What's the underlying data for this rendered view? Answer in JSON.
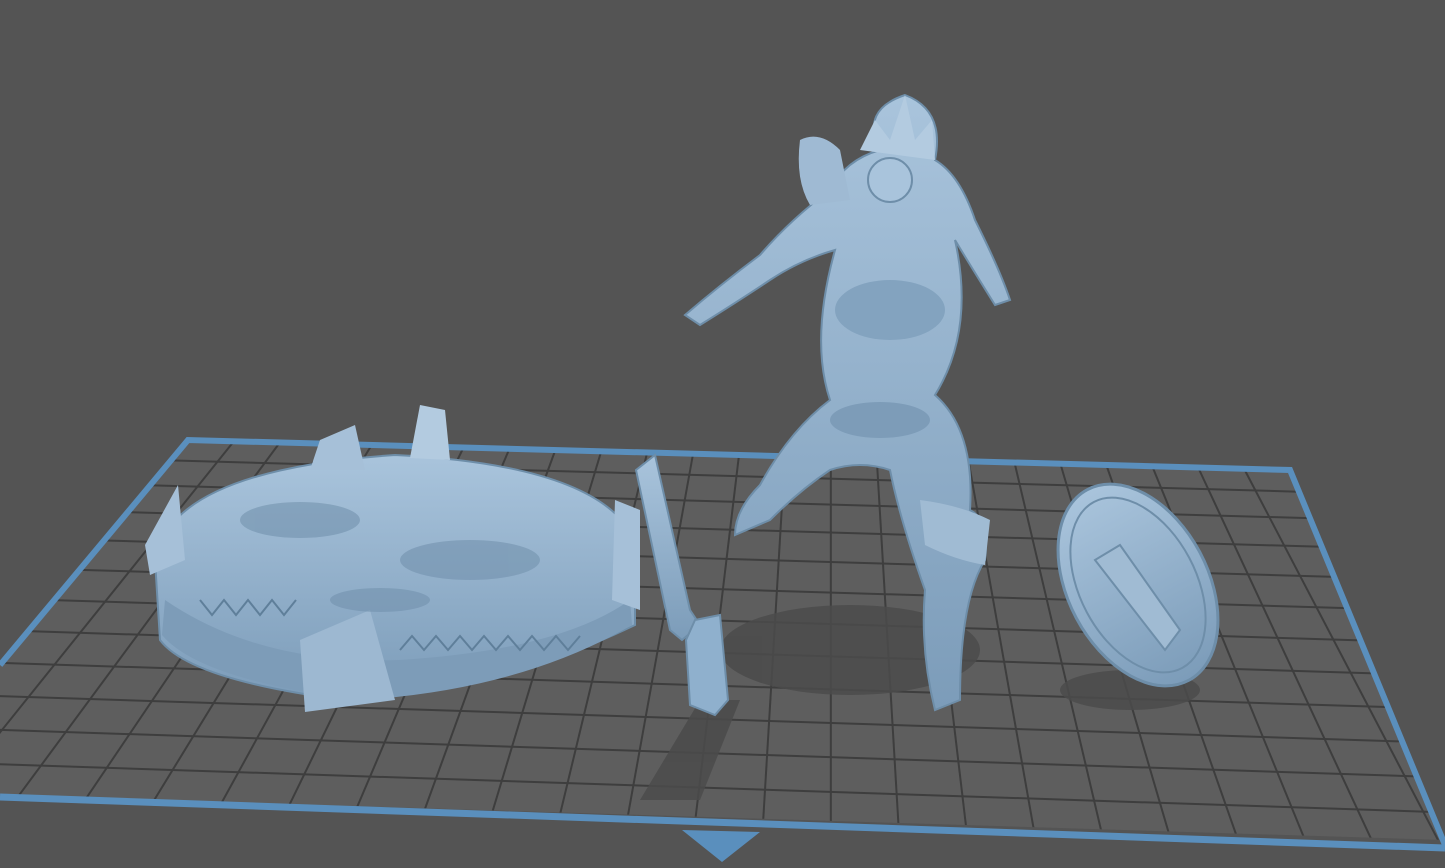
{
  "viewport": {
    "background": "#545454",
    "plate_fill": "#5e5e5e",
    "grid_line": "#3e3e3e",
    "plate_border": "#5a8fbd",
    "model_color": "#8fb0cd",
    "model_shadow": "#4a4a4a",
    "view_indicator": "front-arrow-icon"
  },
  "models": [
    {
      "name": "base-model",
      "kind": "round-base"
    },
    {
      "name": "sword-model",
      "kind": "sword"
    },
    {
      "name": "figure-model",
      "kind": "warrior-figure"
    },
    {
      "name": "shield-model",
      "kind": "shield"
    }
  ]
}
